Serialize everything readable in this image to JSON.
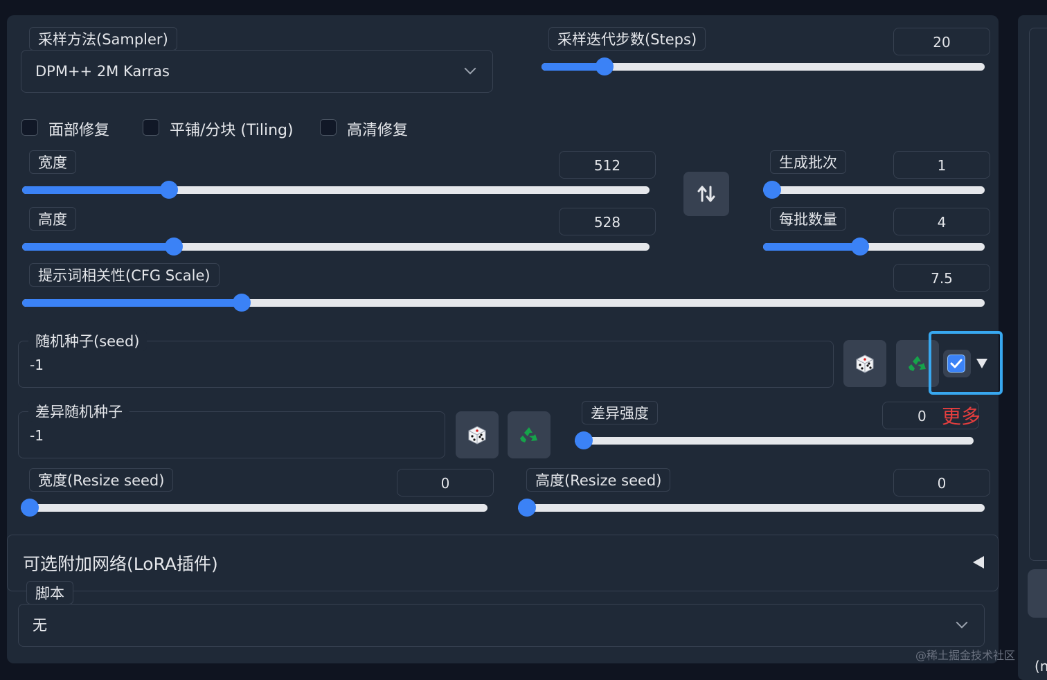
{
  "sampler": {
    "label": "采样方法(Sampler)",
    "value": "DPM++ 2M Karras"
  },
  "steps": {
    "label": "采样迭代步数(Steps)",
    "value": "20",
    "min": 1,
    "max": 150,
    "current": 20
  },
  "checkboxes": [
    {
      "label": "面部修复",
      "checked": false
    },
    {
      "label": "平铺/分块 (Tiling)",
      "checked": false
    },
    {
      "label": "高清修复",
      "checked": false
    }
  ],
  "width": {
    "label": "宽度",
    "value": "512",
    "fraction": 0.234
  },
  "height": {
    "label": "高度",
    "value": "528",
    "fraction": 0.242
  },
  "batch_count": {
    "label": "生成批次",
    "value": "1",
    "fraction": 0.0
  },
  "batch_size": {
    "label": "每批数量",
    "value": "4",
    "fraction": 0.438
  },
  "cfg": {
    "label": "提示词相关性(CFG Scale)",
    "value": "7.5",
    "fraction": 0.228
  },
  "seed": {
    "label": "随机种子(seed)",
    "value": "-1",
    "extra_checked": true
  },
  "var_seed": {
    "label": "差异随机种子",
    "value": "-1"
  },
  "var_strength": {
    "label": "差异强度",
    "value": "0",
    "fraction": 0.0
  },
  "more_annotation": "更多",
  "resize_w": {
    "label": "宽度(Resize seed)",
    "value": "0",
    "fraction": 0.0
  },
  "resize_h": {
    "label": "高度(Resize seed)",
    "value": "0",
    "fraction": 0.0
  },
  "accordion": {
    "title": "可选附加网络(LoRA插件)"
  },
  "script": {
    "label": "脚本",
    "value": "无"
  },
  "watermark": "@稀土掘金技术社区",
  "edge_text": "(n",
  "colors": {
    "accent": "#3b82f6",
    "panel": "#1f2937",
    "highlight": "#38a8f0",
    "annotation": "#e53e3e"
  },
  "icons": {
    "dice": "dice-icon",
    "recycle": "recycle-icon",
    "swap": "swap-icon"
  }
}
